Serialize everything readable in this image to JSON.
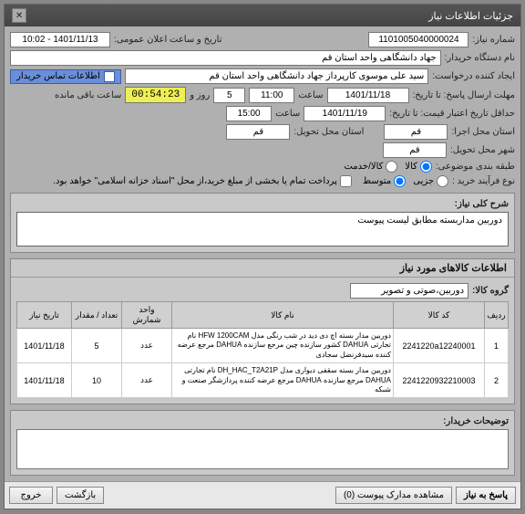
{
  "title": "جزئیات اطلاعات نیاز",
  "form": {
    "need_no_label": "شماره نیاز:",
    "need_no": "1101005040000024",
    "announce_label": "تاریخ و ساعت اعلان عمومی:",
    "announce_value": "1401/11/13 - 10:02",
    "buyer_org_label": "نام دستگاه خریدار:",
    "buyer_org": "جهاد دانشگاهی واحد استان قم",
    "requester_label": "ایجاد کننده درخواست:",
    "requester": "سید علی موسوی کارپرداز جهاد دانشگاهی واحد استان قم",
    "contact_note": "اطلاعات تماس خریدار",
    "deadline_label": "مهلت ارسال پاسخ: تا تاریخ:",
    "deadline_date": "1401/11/18",
    "time_label": "ساعت",
    "deadline_time": "11:00",
    "days_label": "روز و",
    "days": "5",
    "remain_label": "ساعت باقی مانده",
    "countdown": "00:54:23",
    "validity_label": "حداقل تاریخ اعتبار قیمت: تا تاریخ:",
    "validity_date": "1401/11/19",
    "validity_time": "15:00",
    "exec_province_label": "استان محل اجرا:",
    "exec_province": "قم",
    "deliver_province_label": "استان محل تحویل:",
    "deliver_province": "قم",
    "deliver_city_label": "شهر محل تحویل:",
    "deliver_city": "قم",
    "subject_group_label": "طبقه بندی موضوعی:",
    "subject_goods": "کالا",
    "subject_service": "کالا/خدمت",
    "purchase_type_label": "نوع فرآیند خرید :",
    "pt_minor": "جزیی",
    "pt_mid": "متوسط",
    "pay_note": "پرداخت تمام یا بخشی از مبلغ خرید،از محل \"اسناد خزانه اسلامی\" خواهد بود."
  },
  "desc_section": {
    "header": "شرح کلی نیاز:",
    "text": "دوربین مداربسته مطابق لیست پیوست"
  },
  "items_section": {
    "header": "اطلاعات کالاهای مورد نیاز",
    "goods_group_label": "گروه کالا:",
    "goods_group": "دوربین،صوتی و تصویر",
    "cols": {
      "row": "ردیف",
      "code": "کد کالا",
      "name": "نام کالا",
      "unit": "واحد شمارش",
      "qty": "تعداد / مقدار",
      "need_date": "تاریخ نیاز"
    },
    "rows": [
      {
        "n": "1",
        "code": "2241220a12240001",
        "name": "دوربین مدار بسته اچ دی دید در شب رنگی مدل HFW 1200CAM نام تجارتی DAHUA کشور سازنده چین مرجع سازنده DAHUA مرجع عرضه کننده سیدفرنضل سجادی",
        "unit": "عدد",
        "qty": "5",
        "date": "1401/11/18"
      },
      {
        "n": "2",
        "code": "2241220932210003",
        "name": "دوربین مدار بسته سقفی دیواری مدل DH_HAC_T2A21P نام تجارتی DAHUA مرجع سازنده DAHUA مرجع عرضه کننده پردازشگر صنعت و شبکه",
        "unit": "عدد",
        "qty": "10",
        "date": "1401/11/18"
      }
    ]
  },
  "buyer_notes": {
    "header": "توضیحات خریدار:"
  },
  "footer": {
    "respond": "پاسخ به نیاز",
    "view_docs": "مشاهده مدارک پیوست (0)",
    "back": "بازگشت",
    "exit": "خروج"
  }
}
